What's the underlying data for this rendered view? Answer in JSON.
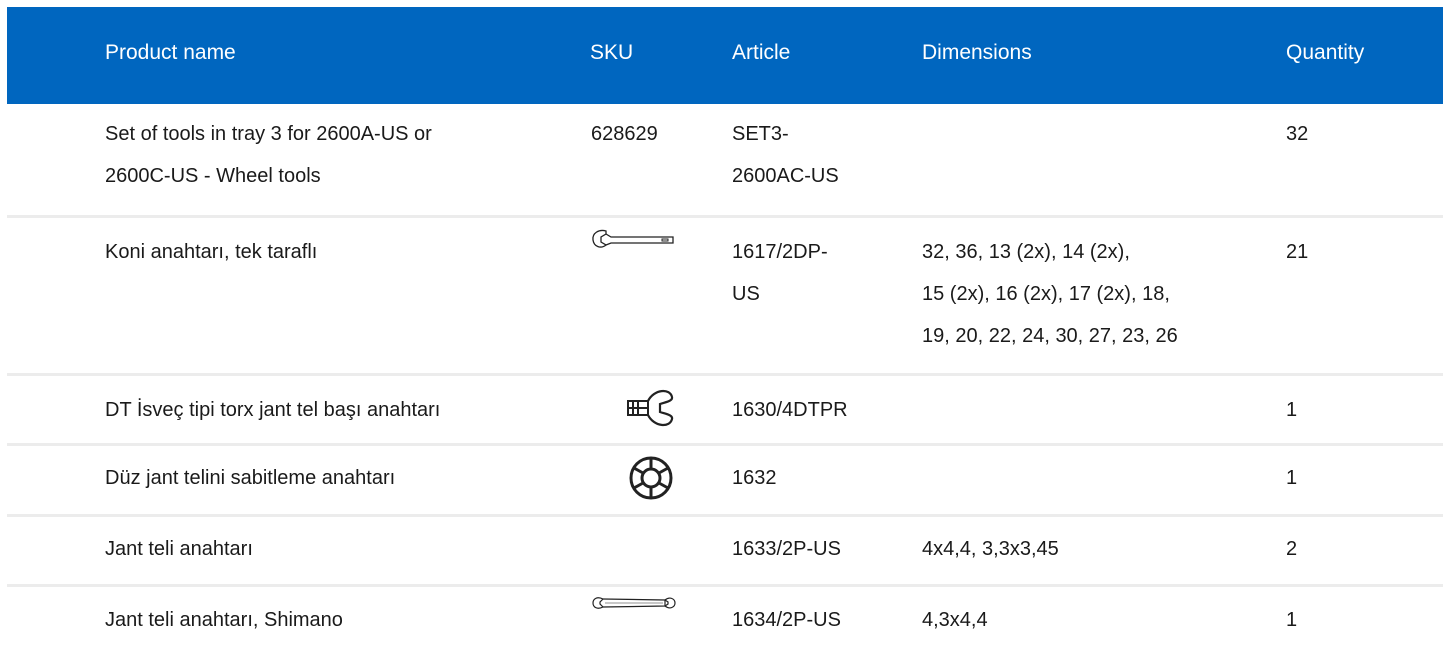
{
  "columns": {
    "name": "Product name",
    "sku": "SKU",
    "article": "Article",
    "dimensions": "Dimensions",
    "quantity": "Quantity"
  },
  "rows": [
    {
      "name_line1": "Set of tools in tray 3 for 2600A-US or",
      "name_line2": "2600C-US - Wheel tools",
      "sku": "628629",
      "article_line1": "SET3-",
      "article_line2": "2600AC-US",
      "dimensions": "",
      "quantity": "32"
    },
    {
      "name": "Koni anahtarı, tek taraflı",
      "icon": "cone-wrench-icon",
      "article_line1": "1617/2DP-",
      "article_line2": "US",
      "dimensions_line1": "32, 36, 13 (2x), 14 (2x),",
      "dimensions_line2": "15 (2x), 16 (2x), 17 (2x), 18,",
      "dimensions_line3": "19, 20, 22, 24, 30, 27, 23, 26",
      "quantity": "21"
    },
    {
      "name": "DT İsveç tipi torx jant tel başı anahtarı",
      "icon": "torx-spoke-wrench-icon",
      "article": "1630/4DTPR",
      "dimensions": "",
      "quantity": "1"
    },
    {
      "name": "Düz jant telini sabitleme anahtarı",
      "icon": "round-spoke-holder-icon",
      "article": "1632",
      "dimensions": "",
      "quantity": "1"
    },
    {
      "name": "Jant teli anahtarı",
      "article": "1633/2P-US",
      "dimensions": "4x4,4, 3,3x3,45",
      "quantity": "2"
    },
    {
      "name": "Jant teli anahtarı, Shimano",
      "icon": "double-spoke-wrench-icon",
      "article": "1634/2P-US",
      "dimensions": "4,3x4,4",
      "quantity": "1"
    }
  ]
}
